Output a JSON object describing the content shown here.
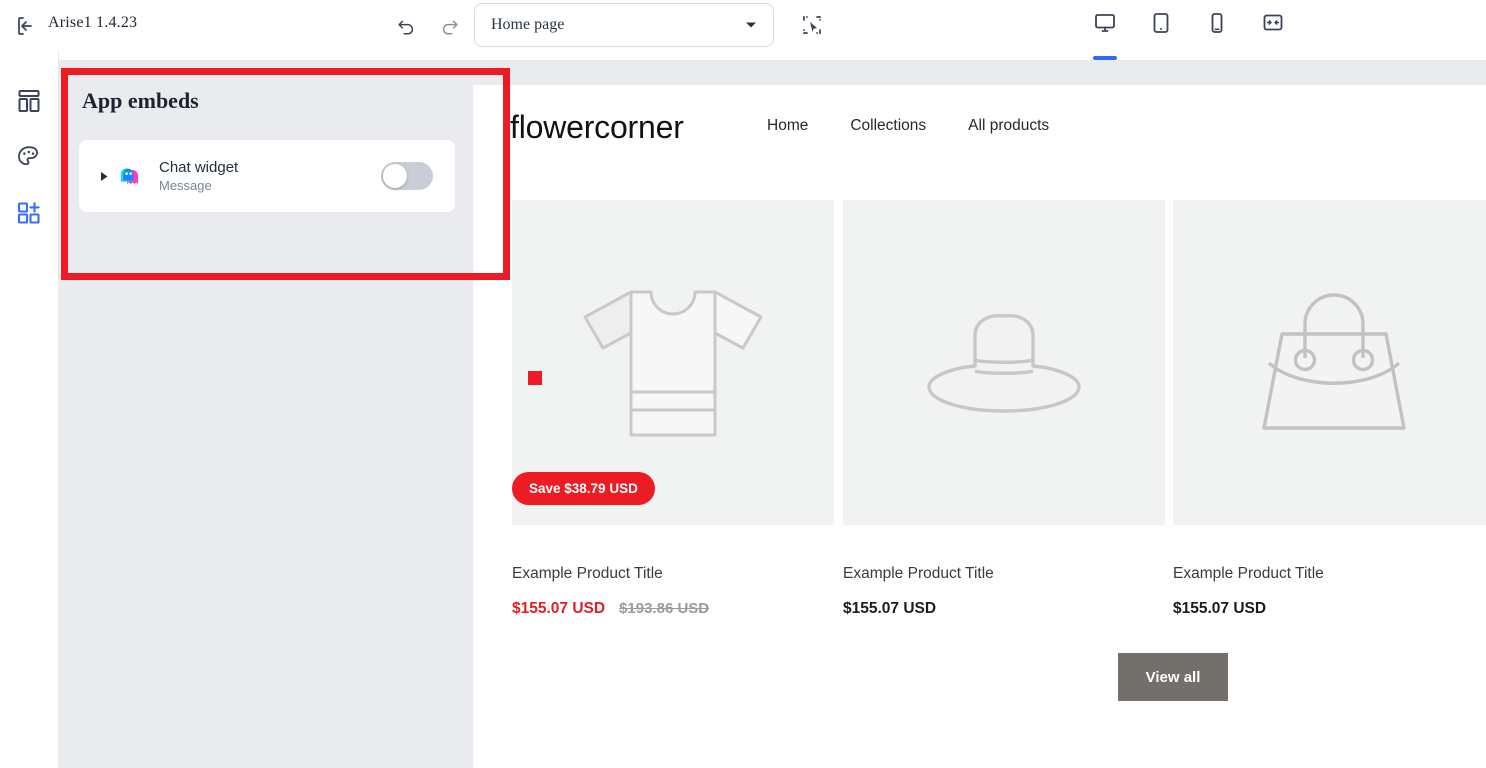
{
  "topbar": {
    "exit_icon": "exit-left-icon",
    "theme_title": "Arise1  1.4.23",
    "undo_icon": "undo-arrow-icon",
    "redo_icon": "redo-arrow-icon",
    "page_selector": {
      "value": "Home page",
      "caret_icon": "chevron-down-icon"
    },
    "select_tool_icon": "marquee-select-icon",
    "devices": [
      {
        "name": "desktop",
        "icon": "desktop-monitor-icon",
        "active": true
      },
      {
        "name": "tablet",
        "icon": "tablet-icon",
        "active": false
      },
      {
        "name": "mobile",
        "icon": "mobile-phone-icon",
        "active": false
      },
      {
        "name": "fullscreen",
        "icon": "fullscreen-expand-icon",
        "active": false
      }
    ],
    "accent_color": "#2d6cf6"
  },
  "rail": {
    "items": [
      {
        "name": "sections",
        "icon": "layout-sections-icon",
        "active": false
      },
      {
        "name": "theme-settings",
        "icon": "palette-icon",
        "active": false
      },
      {
        "name": "app-embeds",
        "icon": "apps-grid-plus-icon",
        "active": true
      }
    ],
    "active_color": "#3b6cf6",
    "inactive_color": "#3c4257"
  },
  "panel": {
    "title": "App embeds",
    "background": "#e9ebee",
    "embeds": [
      {
        "disclosure_icon": "triangle-right-icon",
        "app_icon": "chat-widget-ghost-icon",
        "name": "Chat widget",
        "subtitle": "Message",
        "enabled": false,
        "toggle_track_color": "#c9cdd6"
      }
    ]
  },
  "annotation": {
    "rect_color": "#ed1c24",
    "marker_color": "#ed1c24"
  },
  "preview": {
    "store": {
      "logo": "flowercorner",
      "nav": [
        {
          "label": "Home"
        },
        {
          "label": "Collections"
        },
        {
          "label": "All products"
        }
      ]
    },
    "products": [
      {
        "image_icon": "tshirt-placeholder-icon",
        "badge": "Save $38.79 USD",
        "title": "Example Product Title",
        "price": "$155.07 USD",
        "compare_price": "$193.86 USD",
        "on_sale": true
      },
      {
        "image_icon": "hat-placeholder-icon",
        "badge": "",
        "title": "Example Product Title",
        "price": "$155.07 USD",
        "compare_price": "",
        "on_sale": false
      },
      {
        "image_icon": "handbag-placeholder-icon",
        "badge": "",
        "title": "Example Product Title",
        "price": "$155.07 USD",
        "compare_price": "",
        "on_sale": false
      }
    ],
    "view_all_label": "View all",
    "view_all_color": "#73706c",
    "sale_color": "#e01f26"
  }
}
